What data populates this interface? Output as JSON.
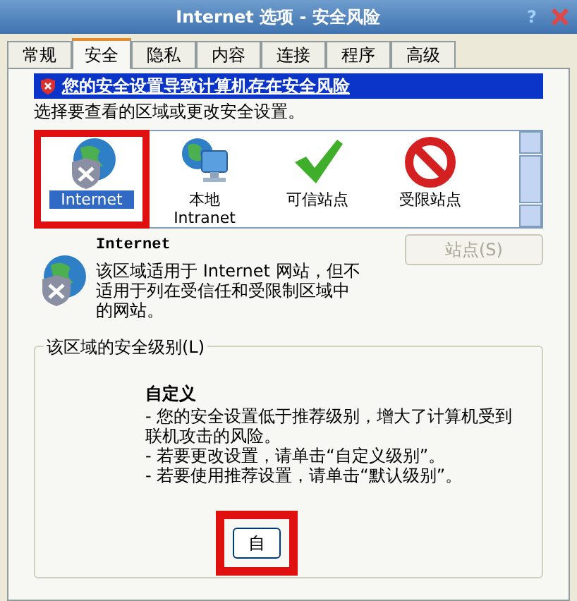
{
  "window": {
    "title": "Internet 选项 - 安全风险",
    "help": "?"
  },
  "tabs": [
    {
      "label": "常规",
      "selected": false
    },
    {
      "label": "安全",
      "selected": true
    },
    {
      "label": "隐私",
      "selected": false
    },
    {
      "label": "内容",
      "selected": false
    },
    {
      "label": "连接",
      "selected": false
    },
    {
      "label": "程序",
      "selected": false
    },
    {
      "label": "高级",
      "selected": false
    }
  ],
  "warning_banner": "您的安全设置导致计算机存在安全风险",
  "instruction": "选择要查看的区域或更改安全设置。",
  "zones": [
    {
      "kind": "internet",
      "label": "Internet",
      "selected": true,
      "annotated": true
    },
    {
      "kind": "intranet",
      "label": "本地 Intranet",
      "selected": false,
      "annotated": false
    },
    {
      "kind": "trusted",
      "label": "可信站点",
      "selected": false,
      "annotated": false
    },
    {
      "kind": "restricted",
      "label": "受限站点",
      "selected": false,
      "annotated": false
    }
  ],
  "zone_info": {
    "name": "Internet",
    "description": "该区域适用于 Internet 网站，但不适用于列在受信任和受限制区域中的网站。"
  },
  "sites_button": {
    "label": "站点(S)",
    "disabled": true
  },
  "security_level": {
    "legend": "该区域的安全级别(L)",
    "level_name": "自定义",
    "lines": [
      "- 您的安全设置低于推荐级别，增大了计算机受到联机攻击的风险。",
      "- 若要更改设置，请单击“自定义级别”。",
      "- 若要使用推荐设置，请单击“默认级别”。"
    ],
    "custom_button": {
      "label": "自",
      "annotated": true
    }
  }
}
